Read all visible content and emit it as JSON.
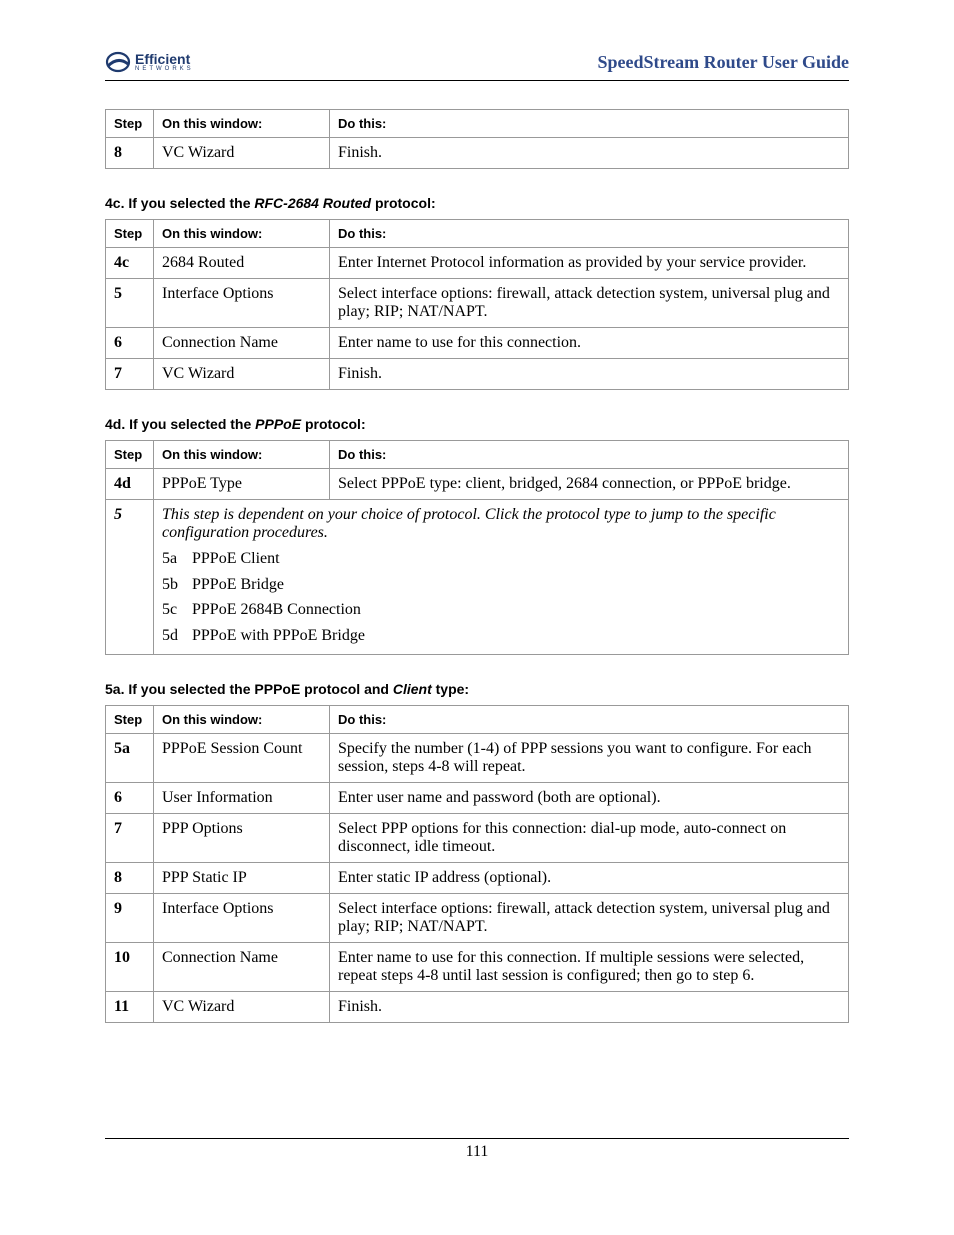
{
  "header": {
    "logoTop": "Efficient",
    "logoBottom": "NETWORKS",
    "title": "SpeedStream Router User Guide"
  },
  "columns": {
    "step": "Step",
    "window": "On this window:",
    "do": "Do this:"
  },
  "tableTop": {
    "rows": [
      {
        "step": "8",
        "window": "VC Wizard",
        "do": "Finish."
      }
    ]
  },
  "section4c": {
    "headingPrefix": "4c. If you selected the ",
    "proto": "RFC-2684 Routed",
    "headingSuffix": " protocol:",
    "rows": [
      {
        "step": "4c",
        "window": "2684 Routed",
        "do": "Enter Internet Protocol information as provided by your service provider."
      },
      {
        "step": "5",
        "window": "Interface Options",
        "do": "Select interface options: firewall, attack detection system, universal plug and play; RIP; NAT/NAPT."
      },
      {
        "step": "6",
        "window": "Connection Name",
        "do": "Enter name to use for this connection."
      },
      {
        "step": "7",
        "window": "VC Wizard",
        "do": "Finish."
      }
    ]
  },
  "section4d": {
    "headingPrefix": "4d. If you selected the ",
    "proto": "PPPoE",
    "headingSuffix": " protocol:",
    "rows": [
      {
        "step": "4d",
        "window": "PPPoE Type",
        "do": "Select PPPoE type: client, bridged, 2684 connection, or PPPoE bridge."
      }
    ],
    "mergedStep": "5",
    "mergedNote": "This step is dependent on your choice of protocol. Click the protocol type to jump to the specific configuration procedures.",
    "subItems": [
      {
        "key": "5a",
        "label": "PPPoE Client"
      },
      {
        "key": "5b",
        "label": "PPPoE Bridge"
      },
      {
        "key": "5c",
        "label": "PPPoE 2684B Connection"
      },
      {
        "key": "5d",
        "label": "PPPoE with PPPoE Bridge"
      }
    ]
  },
  "section5a": {
    "headingPrefix": "5a. If you selected the ",
    "proto1": "PPPoE",
    "middle": " protocol and ",
    "proto2": "Client",
    "headingSuffix": " type:",
    "rows": [
      {
        "step": "5a",
        "window": "PPPoE Session Count",
        "do": "Specify the number (1-4) of PPP sessions you want to configure. For each session, steps 4-8 will repeat."
      },
      {
        "step": "6",
        "window": "User Information",
        "do": "Enter user name and password (both are optional)."
      },
      {
        "step": "7",
        "window": "PPP Options",
        "do": "Select PPP options for this connection: dial-up mode, auto-connect on disconnect, idle timeout."
      },
      {
        "step": "8",
        "window": "PPP Static IP",
        "do": "Enter static IP address (optional)."
      },
      {
        "step": "9",
        "window": "Interface Options",
        "do": "Select interface options: firewall, attack detection system, universal plug and play; RIP; NAT/NAPT."
      },
      {
        "step": "10",
        "window": "Connection Name",
        "do": "Enter name to use for this connection. If multiple sessions were selected, repeat steps 4-8 until last session is configured; then go to step 6."
      },
      {
        "step": "11",
        "window": "VC Wizard",
        "do": "Finish."
      }
    ]
  },
  "pageNumber": "111"
}
